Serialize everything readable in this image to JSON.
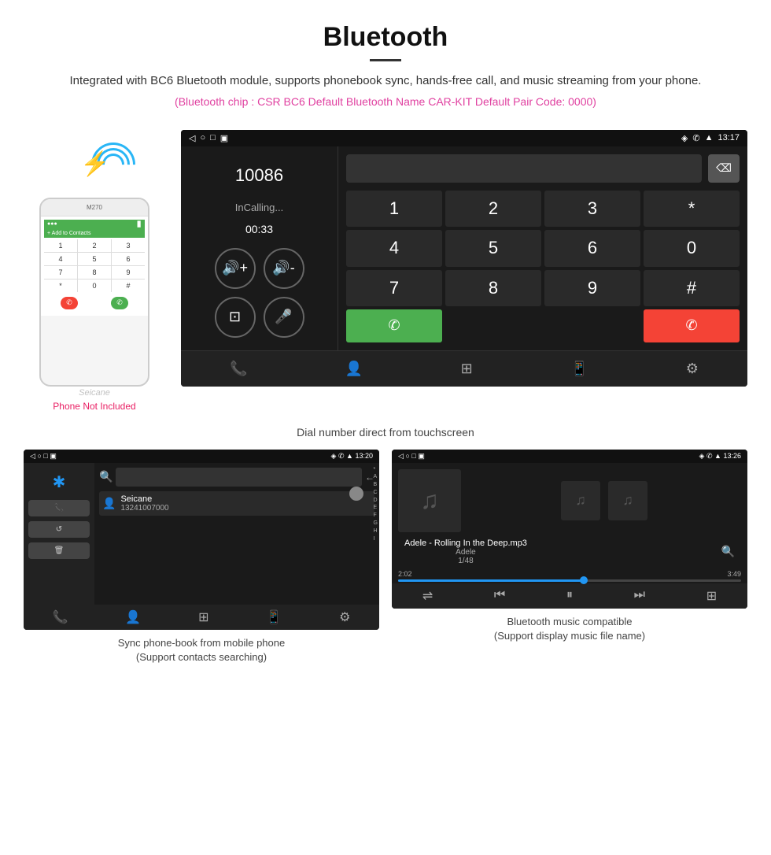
{
  "header": {
    "title": "Bluetooth",
    "description": "Integrated with BC6 Bluetooth module, supports phonebook sync, hands-free call, and music streaming from your phone.",
    "specs": "(Bluetooth chip : CSR BC6    Default Bluetooth Name CAR-KIT    Default Pair Code: 0000)"
  },
  "dialScreen": {
    "statusBar": {
      "leftIcons": "◁  ○  □  ▣",
      "rightInfo": "13:17"
    },
    "number": "10086",
    "callStatus": "InCalling...",
    "timer": "00:33",
    "dialKeys": [
      "1",
      "2",
      "3",
      "*",
      "4",
      "5",
      "6",
      "0",
      "7",
      "8",
      "9",
      "#"
    ],
    "callGreenLabel": "📞",
    "callRedLabel": "📞"
  },
  "caption1": "Dial number direct from touchscreen",
  "phonebook": {
    "statusBar": {
      "rightInfo": "13:20"
    },
    "contactName": "Seicane",
    "contactPhone": "13241007000",
    "alphabetList": [
      "*",
      "A",
      "B",
      "C",
      "D",
      "E",
      "F",
      "G",
      "H",
      "I"
    ]
  },
  "musicScreen": {
    "statusBar": {
      "rightInfo": "13:26"
    },
    "songName": "Adele - Rolling In the Deep.mp3",
    "artist": "Adele",
    "track": "1/48",
    "currentTime": "2:02",
    "totalTime": "3:49",
    "progressPercent": 54
  },
  "caption2": {
    "line1": "Sync phone-book from mobile phone",
    "line2": "(Support contacts searching)"
  },
  "caption3": {
    "line1": "Bluetooth music compatible",
    "line2": "(Support display music file name)"
  },
  "phoneNotIncluded": "Phone Not Included",
  "seicane": "Seicane"
}
